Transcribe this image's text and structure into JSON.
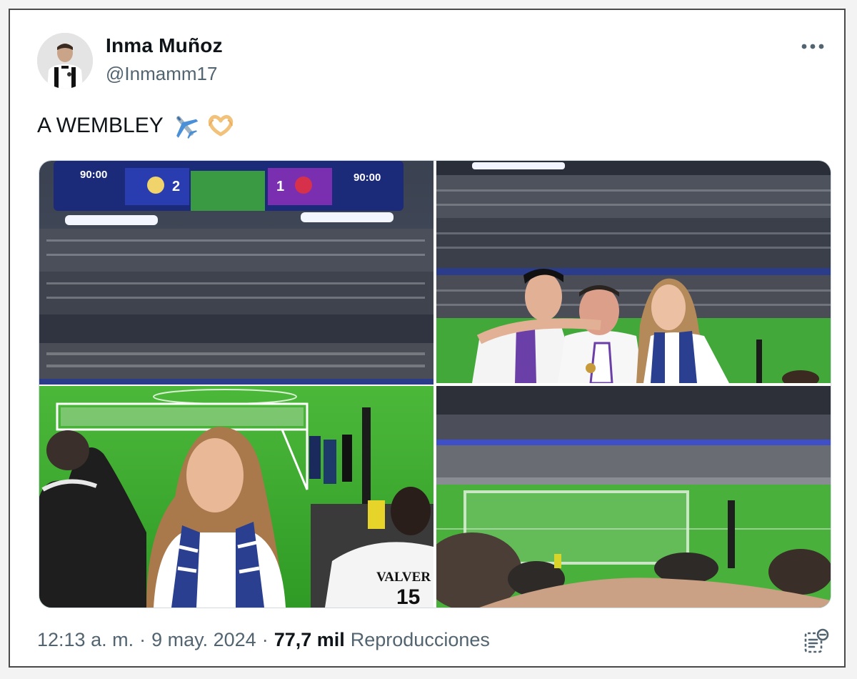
{
  "author": {
    "name": "Inma Muñoz",
    "handle": "@Inmamm17"
  },
  "tweet": {
    "text": "A WEMBLEY",
    "emojis": [
      "airplane-emoji",
      "heart-hands-emoji"
    ]
  },
  "media": {
    "scoreboard": {
      "time_left": "90:00",
      "time_right": "90:00",
      "home_score": "2",
      "away_score": "1"
    },
    "shirt_name": "VALVER",
    "shirt_number": "15"
  },
  "footer": {
    "time": "12:13 a. m.",
    "separator": "·",
    "date": "9 may. 2024",
    "views_count": "77,7 mil",
    "views_label": "Reproducciones"
  },
  "colors": {
    "text_primary": "#0f1419",
    "text_secondary": "#536471",
    "border": "#cfd9de",
    "pitch_green": "#3fae32",
    "scarf_blue": "#2a3f8f"
  },
  "icons": {
    "more": "more-options-icon",
    "analytics": "analytics-icon"
  }
}
